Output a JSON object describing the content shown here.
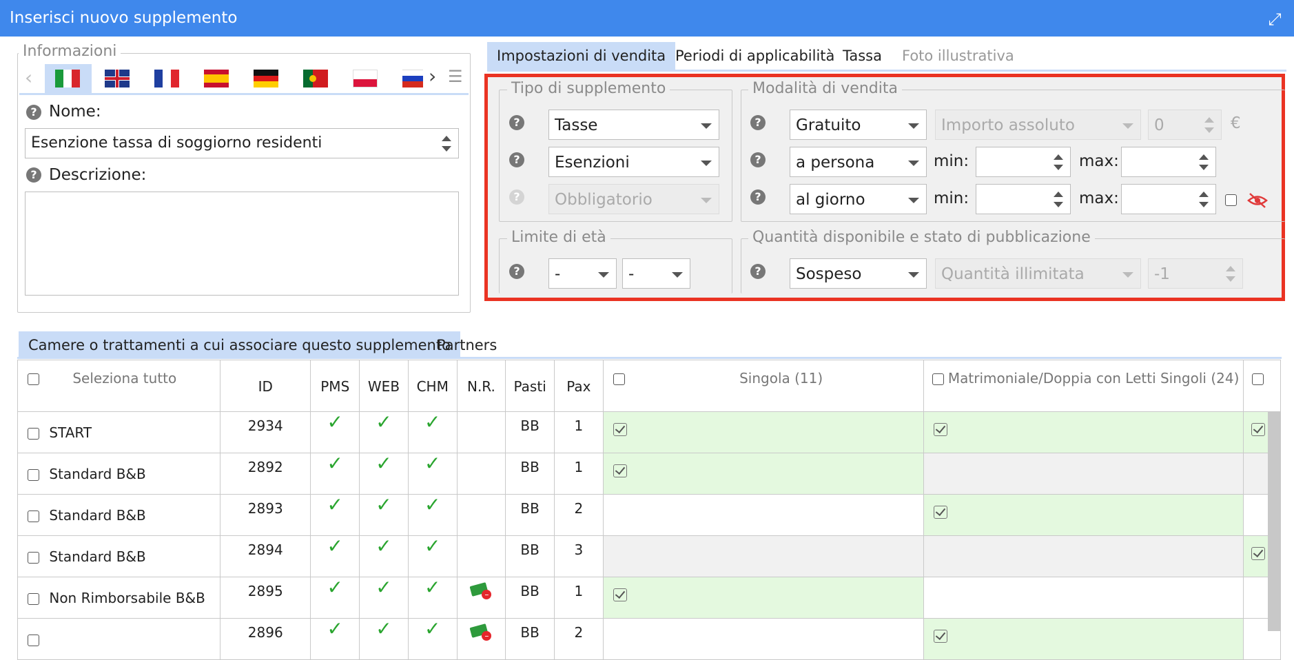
{
  "window": {
    "title": "Inserisci nuovo supplemento"
  },
  "info": {
    "legend": "Informazioni",
    "languages": [
      "Italiano",
      "English",
      "Français",
      "Español",
      "Deutsch",
      "Português",
      "Polski",
      "Русский"
    ],
    "name_label": "Nome:",
    "name_value": "Esenzione tassa di soggiorno residenti",
    "desc_label": "Descrizione:",
    "desc_value": ""
  },
  "settings_tabs": [
    {
      "label": "Impostazioni di vendita",
      "active": true
    },
    {
      "label": "Periodi di applicabilità",
      "active": false
    },
    {
      "label": "Tassa",
      "active": false
    },
    {
      "label": "Foto illustrativa",
      "disabled": true
    }
  ],
  "tipo": {
    "legend": "Tipo di supplemento",
    "category": "Tasse",
    "subcategory": "Esenzioni",
    "mandatory": "Obbligatorio"
  },
  "modalita": {
    "legend": "Modalità di vendita",
    "pricing": "Gratuito",
    "amount_type": "Importo assoluto",
    "amount": "0",
    "currency": "€",
    "per_unit": "a persona",
    "per_time": "al giorno",
    "min_label": "min:",
    "max_label": "max:"
  },
  "eta": {
    "legend": "Limite di età",
    "from": "-",
    "to": "-"
  },
  "quantita": {
    "legend": "Quantità disponibile e stato di pubblicazione",
    "status": "Sospeso",
    "qty_type": "Quantità illimitata",
    "qty": "-1"
  },
  "bottom_tabs": [
    {
      "label": "Camere o trattamenti a cui associare questo supplemento",
      "active": true
    },
    {
      "label": "Partners",
      "active": false
    }
  ],
  "table": {
    "headers": {
      "select_all": "Seleziona tutto",
      "id": "ID",
      "pms": "PMS",
      "web": "WEB",
      "chm": "CHM",
      "nr": "N.R.",
      "pasti": "Pasti",
      "pax": "Pax",
      "room1": "Singola (11)",
      "room2": "Matrimoniale/Doppia con Letti Singoli (24)"
    },
    "rows": [
      {
        "name": "START",
        "id": "2934",
        "pms": true,
        "web": true,
        "chm": true,
        "nr": false,
        "pasti": "BB",
        "pax": "1",
        "r1": "on",
        "r2": "on",
        "r3": "on"
      },
      {
        "name": "Standard B&B",
        "id": "2892",
        "pms": true,
        "web": true,
        "chm": true,
        "nr": false,
        "pasti": "BB",
        "pax": "1",
        "r1": "on",
        "r2": "gray",
        "r3": "gray"
      },
      {
        "name": "Standard B&B",
        "id": "2893",
        "pms": true,
        "web": true,
        "chm": true,
        "nr": false,
        "pasti": "BB",
        "pax": "2",
        "r1": "empty",
        "r2": "on",
        "r3": "empty"
      },
      {
        "name": "Standard B&B",
        "id": "2894",
        "pms": true,
        "web": true,
        "chm": true,
        "nr": false,
        "pasti": "BB",
        "pax": "3",
        "r1": "gray",
        "r2": "gray",
        "r3": "on"
      },
      {
        "name": "Non Rimborsabile B&B",
        "id": "2895",
        "pms": true,
        "web": true,
        "chm": true,
        "nr": true,
        "pasti": "BB",
        "pax": "1",
        "r1": "on",
        "r2": "empty",
        "r3": "empty"
      },
      {
        "name": "",
        "id": "2896",
        "pms": true,
        "web": true,
        "chm": true,
        "nr": true,
        "pasti": "BB",
        "pax": "2",
        "r1": "empty",
        "r2": "on",
        "r3": "empty"
      }
    ]
  }
}
